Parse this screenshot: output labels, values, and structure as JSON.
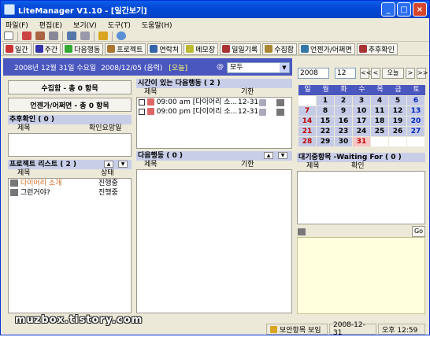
{
  "window": {
    "title": "LiteManager V1.10 - [일간보기]",
    "controls": [
      "_",
      "□",
      "×"
    ]
  },
  "menu": [
    "파일(F)",
    "편집(E)",
    "보기(V)",
    "도구(T)",
    "도움말(H)"
  ],
  "toolbar2": [
    {
      "label": "일간",
      "icon": "calendar-day-icon",
      "color": "#c33"
    },
    {
      "label": "주간",
      "icon": "calendar-week-icon",
      "color": "#33a"
    },
    {
      "label": "다음행동",
      "icon": "pencil-icon",
      "color": "#3a3"
    },
    {
      "label": "프로젝트",
      "icon": "folder-icon",
      "color": "#a73"
    },
    {
      "label": "연락처",
      "icon": "person-icon",
      "color": "#36a"
    },
    {
      "label": "메모장",
      "icon": "memo-icon",
      "color": "#bb3"
    },
    {
      "label": "일일기록",
      "icon": "diary-icon",
      "color": "#a33"
    },
    {
      "label": "수집함",
      "icon": "inbox-icon",
      "color": "#a83"
    },
    {
      "label": "언젠가/어쩌면",
      "icon": "question-icon",
      "color": "#37a"
    },
    {
      "label": "추후확인",
      "icon": "check-icon",
      "color": "#a33"
    }
  ],
  "header": {
    "date": "2008년 12월 31일 수요일",
    "date2": "2008/12/05 (음력)",
    "today": "[오늘]",
    "at": "@",
    "filter": "모두"
  },
  "left": {
    "inbox_btn": "수집함 - 총 0 항목",
    "someday_btn": "언젠가/어쩌면 - 총 0 항목",
    "followup": {
      "title": "추후확인 ( 0 )",
      "cols": [
        "제목",
        "확인요망일"
      ]
    },
    "projects": {
      "title": "프로젝트 리스트 ( 2 )",
      "cols": [
        "제목",
        "상태"
      ],
      "items": [
        {
          "title": "다이어리 소개",
          "status": "진행중",
          "color": "#d2691e"
        },
        {
          "title": "그런거야?",
          "status": "진행중",
          "color": "#000"
        }
      ]
    }
  },
  "middle": {
    "timed": {
      "title": "시간이 있는 다음행동 ( 2 )",
      "cols": [
        "제목",
        "기한"
      ],
      "items": [
        {
          "text": "09:00 am [다이어리 소...",
          "due": "12-31"
        },
        {
          "text": "09:00 pm [다이어리 소...",
          "due": "12-31"
        }
      ]
    },
    "next": {
      "title": "다음행동 ( 0 )",
      "cols": [
        "제목",
        "기한"
      ]
    }
  },
  "right": {
    "year": "2008",
    "month": "12",
    "today_btn": "오늘",
    "prev": "<",
    "prevprev": "<<",
    "next": ">",
    "nextnext": ">>",
    "cal_head": [
      "일",
      "월",
      "화",
      "수",
      "목",
      "금",
      "토"
    ],
    "cal": [
      [
        "",
        "1",
        "2",
        "3",
        "4",
        "5",
        "6"
      ],
      [
        "7",
        "8",
        "9",
        "10",
        "11",
        "12",
        "13"
      ],
      [
        "14",
        "15",
        "16",
        "17",
        "18",
        "19",
        "20"
      ],
      [
        "21",
        "22",
        "23",
        "24",
        "25",
        "26",
        "27"
      ],
      [
        "28",
        "29",
        "30",
        "31",
        "",
        "",
        ""
      ]
    ],
    "waiting": {
      "title": "대기중항목 -Waiting For ( 0 )",
      "cols": [
        "제목",
        "확인"
      ]
    },
    "go": "Go"
  },
  "status": {
    "label": "보안항목 보임",
    "date": "2008-12-31",
    "time": "오후 12:59"
  },
  "watermark": "muzbox.tistory.com"
}
